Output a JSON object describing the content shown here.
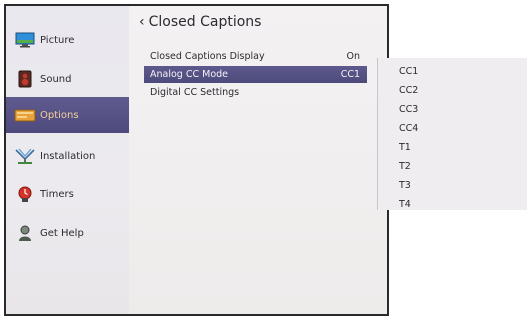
{
  "sidebar": {
    "items": [
      {
        "label": "Picture",
        "icon": "picture-icon"
      },
      {
        "label": "Sound",
        "icon": "speaker-icon"
      },
      {
        "label": "Options",
        "icon": "options-icon",
        "active": true
      },
      {
        "label": "Installation",
        "icon": "antenna-icon"
      },
      {
        "label": "Timers",
        "icon": "timer-icon"
      },
      {
        "label": "Get Help",
        "icon": "help-icon"
      }
    ]
  },
  "main": {
    "title_chevron": "‹",
    "title": "Closed Captions",
    "rows": [
      {
        "label": "Closed Captions Display",
        "value": "On"
      },
      {
        "label": "Analog CC Mode",
        "value": "CC1"
      },
      {
        "label": "Digital CC Settings",
        "value": ""
      }
    ]
  },
  "popup": {
    "options": [
      "CC1",
      "CC2",
      "CC3",
      "CC4",
      "T1",
      "T2",
      "T3",
      "T4"
    ]
  },
  "colors": {
    "highlight": "#524e80",
    "active_sidebar_text": "#f3cf9a",
    "background": "#f0eeef"
  }
}
